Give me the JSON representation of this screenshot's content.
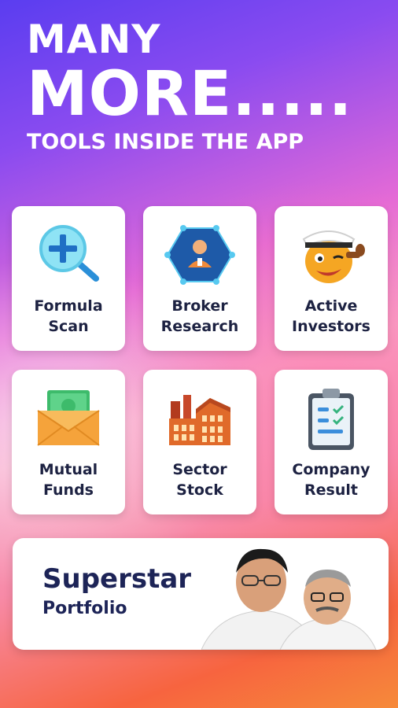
{
  "headline": {
    "line1": "MANY",
    "line2": "MORE.....",
    "line3": "TOOLS INSIDE THE APP"
  },
  "tools": [
    {
      "line1": "Formula",
      "line2": "Scan",
      "icon": "magnifier-plus-icon"
    },
    {
      "line1": "Broker",
      "line2": "Research",
      "icon": "broker-network-icon"
    },
    {
      "line1": "Active",
      "line2": "Investors",
      "icon": "sailor-face-icon"
    },
    {
      "line1": "Mutual",
      "line2": "Funds",
      "icon": "money-envelope-icon"
    },
    {
      "line1": "Sector",
      "line2": "Stock",
      "icon": "factory-icon"
    },
    {
      "line1": "Company",
      "line2": "Result",
      "icon": "clipboard-check-icon"
    }
  ],
  "banner": {
    "title": "Superstar",
    "subtitle": "Portfolio",
    "image": "investor-portraits"
  },
  "colors": {
    "card_text": "#1d2242",
    "banner_text": "#1d2457",
    "headline_text": "#ffffff"
  }
}
